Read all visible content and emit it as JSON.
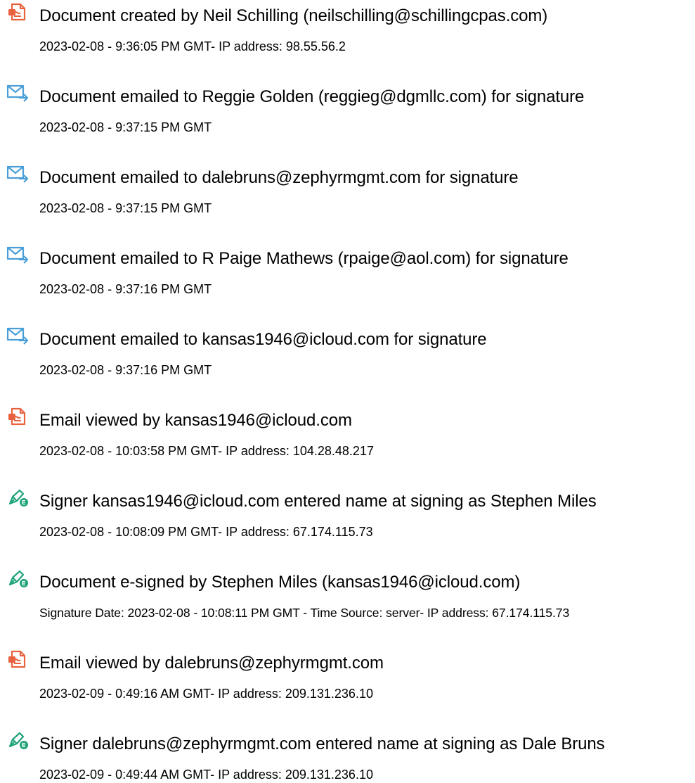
{
  "colors": {
    "document_icon": "#e8623f",
    "email_icon": "#4a9fd8",
    "sign_icon": "#1ea37a",
    "text": "#000000"
  },
  "events": [
    {
      "icon": "document-icon",
      "title": "Document created by Neil Schilling (neilschilling@schillingcpas.com)",
      "detail": "2023-02-08 - 9:36:05 PM GMT- IP address: 98.55.56.2"
    },
    {
      "icon": "email-send-icon",
      "title": "Document emailed to Reggie Golden (reggieg@dgmllc.com) for signature",
      "detail": "2023-02-08 - 9:37:15 PM GMT"
    },
    {
      "icon": "email-send-icon",
      "title": "Document emailed to dalebruns@zephyrmgmt.com for signature",
      "detail": "2023-02-08 - 9:37:15 PM GMT"
    },
    {
      "icon": "email-send-icon",
      "title": "Document emailed to R Paige Mathews (rpaige@aol.com) for signature",
      "detail": "2023-02-08 - 9:37:16 PM GMT"
    },
    {
      "icon": "email-send-icon",
      "title": "Document emailed to kansas1946@icloud.com for signature",
      "detail": "2023-02-08 - 9:37:16 PM GMT"
    },
    {
      "icon": "document-icon",
      "title": "Email viewed by kansas1946@icloud.com",
      "detail": "2023-02-08 - 10:03:58 PM GMT- IP address: 104.28.48.217"
    },
    {
      "icon": "pen-sign-icon",
      "title": "Signer kansas1946@icloud.com entered name at signing as Stephen Miles",
      "detail": "2023-02-08 - 10:08:09 PM GMT- IP address: 67.174.115.73"
    },
    {
      "icon": "pen-sign-icon",
      "title": "Document e-signed by Stephen Miles (kansas1946@icloud.com)",
      "detail": "Signature Date: 2023-02-08 - 10:08:11 PM GMT - Time Source: server- IP address: 67.174.115.73"
    },
    {
      "icon": "document-icon",
      "title": "Email viewed by dalebruns@zephyrmgmt.com",
      "detail": "2023-02-09 - 0:49:16 AM GMT- IP address: 209.131.236.10"
    },
    {
      "icon": "pen-sign-icon",
      "title": "Signer dalebruns@zephyrmgmt.com entered name at signing as Dale Bruns",
      "detail": "2023-02-09 - 0:49:44 AM GMT- IP address: 209.131.236.10"
    }
  ]
}
